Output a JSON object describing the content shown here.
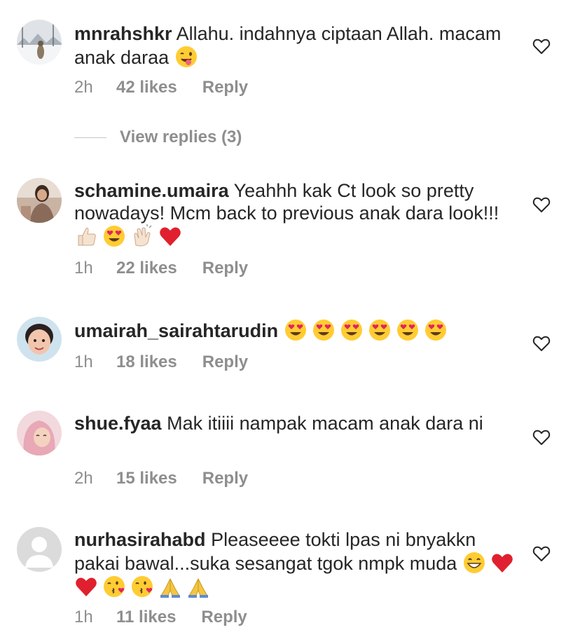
{
  "comments": [
    {
      "username": "mnrahshkr",
      "text": "Allahu. indahnya ciptaan Allah. macam anak daraa",
      "emojis": [
        "winking-face-with-tongue-emoji"
      ],
      "time": "2h",
      "likes": "42 likes",
      "reply": "Reply",
      "avatar": "snowy-landscape-photo-avatar"
    },
    {
      "username": "schamine.umaira",
      "text": "Yeahhh kak Ct look so pretty nowadays! Mcm back to previous anak dara look!!!",
      "emojis": [
        "thumbs-up-emoji",
        "heart-eyes-emoji",
        "clapping-hands-emoji",
        "red-heart-emoji"
      ],
      "time": "1h",
      "likes": "22 likes",
      "reply": "Reply",
      "avatar": "person-photo-avatar"
    },
    {
      "username": "umairah_sairahtarudin",
      "text": "",
      "emojis": [
        "heart-eyes-emoji",
        "heart-eyes-emoji",
        "heart-eyes-emoji",
        "heart-eyes-emoji",
        "heart-eyes-emoji",
        "heart-eyes-emoji"
      ],
      "time": "1h",
      "likes": "18 likes",
      "reply": "Reply",
      "avatar": "smiling-face-photo-avatar"
    },
    {
      "username": "shue.fyaa",
      "text": "Mak itiiii nampak macam anak dara ni",
      "emojis": [],
      "time": "2h",
      "likes": "15 likes",
      "reply": "Reply",
      "avatar": "pink-hijab-photo-avatar"
    },
    {
      "username": "nurhasirahabd",
      "text": "Pleaseeee tokti lpas ni bnyakkn pakai bawal...suka sesangat tgok nmpk muda",
      "emojis": [
        "grinning-face-emoji",
        "red-heart-emoji",
        "red-heart-emoji",
        "kissing-face-emoji",
        "kissing-face-emoji",
        "folded-hands-emoji",
        "folded-hands-emoji"
      ],
      "time": "1h",
      "likes": "11 likes",
      "reply": "Reply",
      "avatar": "default-user-avatar"
    }
  ],
  "view_replies": {
    "label": "View replies (3)"
  },
  "icons": {
    "like": "heart-outline-icon"
  },
  "colors": {
    "text": "#262626",
    "secondary": "#8e8e8e",
    "divider": "#c7c7c7",
    "heart_red": "#e0245e",
    "emoji_yellow": "#ffcc33"
  }
}
